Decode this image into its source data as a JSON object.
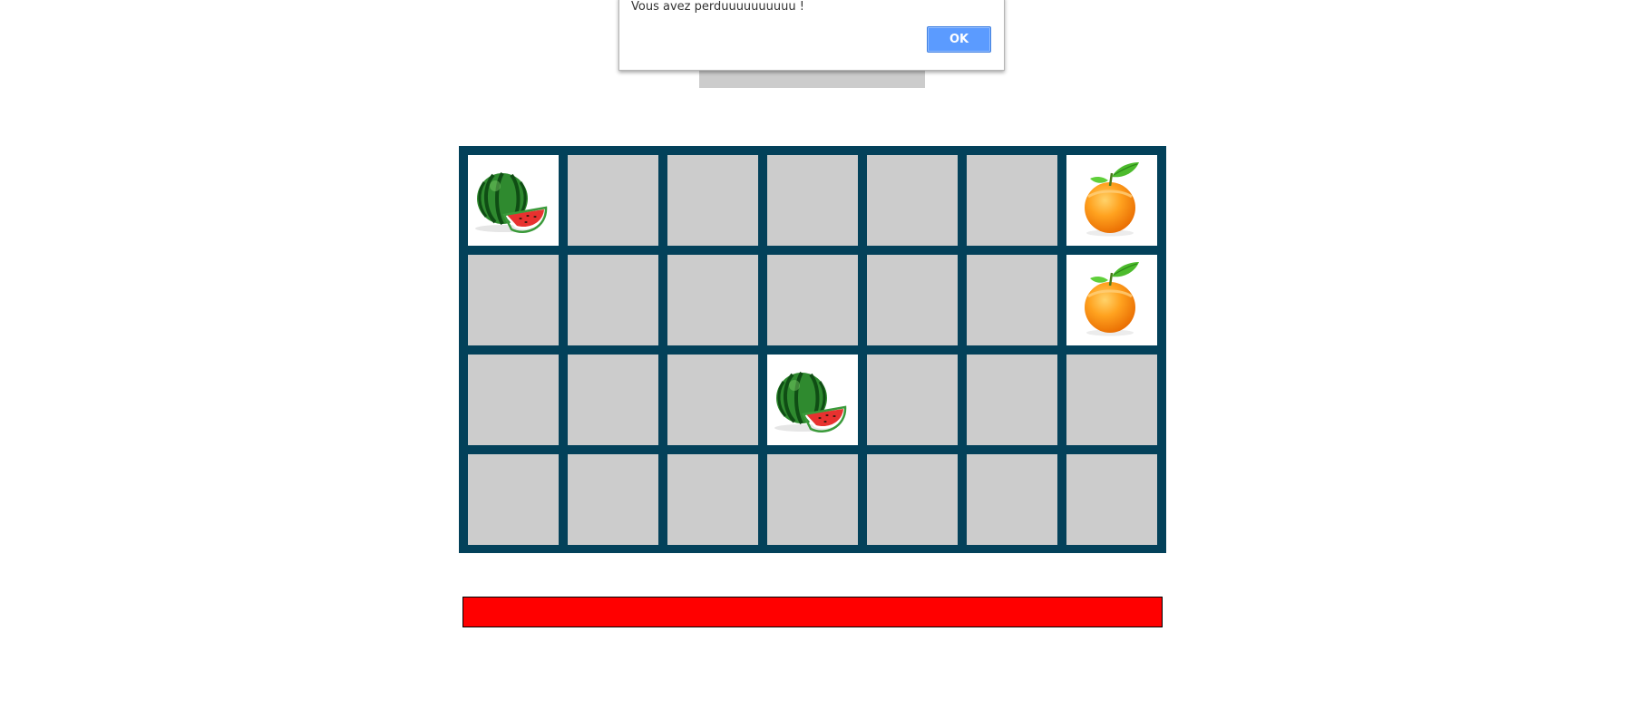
{
  "alert": {
    "message": "Vous avez perduuuuuuuuuu !",
    "ok_label": "OK"
  },
  "board": {
    "rows": 4,
    "cols": 7,
    "cells": [
      [
        "watermelon",
        null,
        null,
        null,
        null,
        null,
        "orange"
      ],
      [
        null,
        null,
        null,
        null,
        null,
        null,
        "orange"
      ],
      [
        null,
        null,
        null,
        "watermelon",
        null,
        null,
        null
      ],
      [
        null,
        null,
        null,
        null,
        null,
        null,
        null
      ]
    ]
  },
  "timer": {
    "progress": 1.0,
    "color": "#ff0000"
  },
  "colors": {
    "board_border": "#03415a",
    "hidden_card": "#cccccc",
    "ok_button": "#5b9bff"
  }
}
